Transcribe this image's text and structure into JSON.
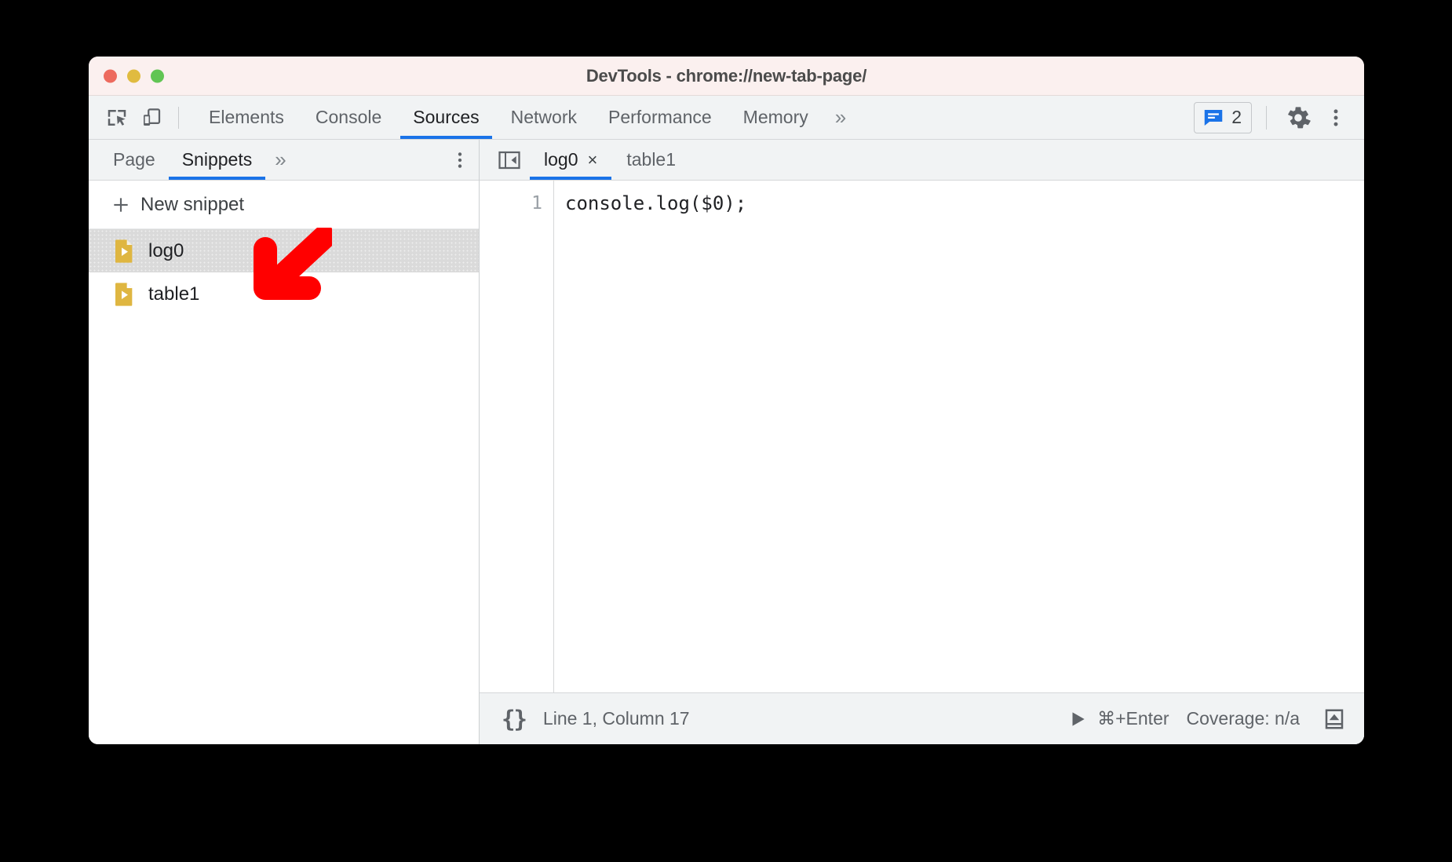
{
  "window": {
    "title": "DevTools - chrome://new-tab-page/",
    "traffic_lights": [
      "close",
      "minimize",
      "zoom"
    ]
  },
  "main_toolbar": {
    "icons": [
      "inspect-element-icon",
      "device-toolbar-icon"
    ],
    "tabs": [
      {
        "label": "Elements",
        "active": false
      },
      {
        "label": "Console",
        "active": false
      },
      {
        "label": "Sources",
        "active": true
      },
      {
        "label": "Network",
        "active": false
      },
      {
        "label": "Performance",
        "active": false
      },
      {
        "label": "Memory",
        "active": false
      }
    ],
    "more_tabs_label": "»",
    "issues": {
      "icon": "issues-message-icon",
      "count": "2",
      "color": "#1a73e8"
    },
    "settings_icon": "gear-icon",
    "menu_icon": "vertical-dots-icon"
  },
  "navigator": {
    "tabs": [
      {
        "label": "Page",
        "active": false
      },
      {
        "label": "Snippets",
        "active": true
      }
    ],
    "more_tabs_label": "»",
    "menu_icon": "vertical-dots-icon",
    "new_snippet_label": "New snippet",
    "new_snippet_icon": "plus-icon",
    "snippets": [
      {
        "label": "log0",
        "icon": "snippet-file-icon",
        "selected": true
      },
      {
        "label": "table1",
        "icon": "snippet-file-icon",
        "selected": false
      }
    ]
  },
  "editor": {
    "collapse_icon": "collapse-sidebar-icon",
    "tabs": [
      {
        "label": "log0",
        "active": true,
        "closable": true
      },
      {
        "label": "table1",
        "active": false,
        "closable": false
      }
    ],
    "close_glyph": "×",
    "line_numbers": [
      "1"
    ],
    "code": "console.log($0);"
  },
  "status_bar": {
    "pretty_print_label": "{}",
    "cursor_position": "Line 1, Column 17",
    "run_icon": "play-triangle-icon",
    "run_shortcut": "⌘+Enter",
    "coverage": "Coverage: n/a",
    "drawer_icon": "show-drawer-icon"
  },
  "annotation": {
    "arrow": "red-arrow-down-left",
    "color": "#ff0000"
  }
}
